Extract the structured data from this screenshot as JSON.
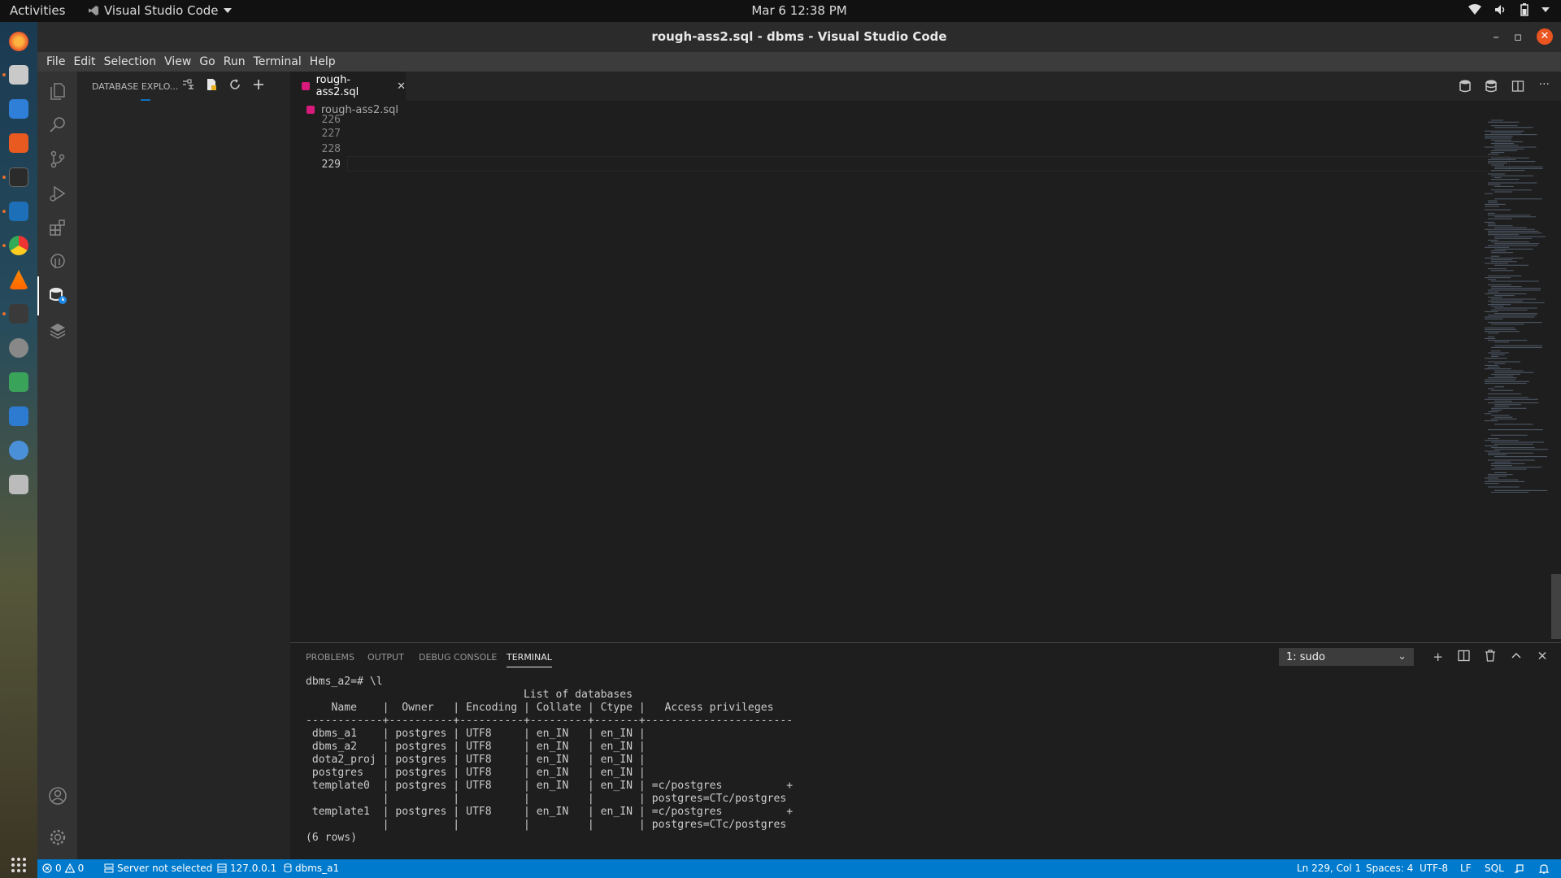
{
  "topbar": {
    "activities": "Activities",
    "app_name": "Visual Studio Code",
    "clock": "Mar 6  12:38 PM"
  },
  "window": {
    "title": "rough-ass2.sql - dbms - Visual Studio Code"
  },
  "menu": [
    "File",
    "Edit",
    "Selection",
    "View",
    "Go",
    "Run",
    "Terminal",
    "Help"
  ],
  "sidebar": {
    "title": "DATABASE EXPLO..."
  },
  "editor": {
    "tab_label": "rough-ass2.sql",
    "breadcrumb": "rough-ass2.sql",
    "line_numbers": [
      "226",
      "227",
      "228",
      "229"
    ]
  },
  "panel": {
    "tabs": [
      "PROBLEMS",
      "OUTPUT",
      "DEBUG CONSOLE",
      "TERMINAL"
    ],
    "active_tab": "TERMINAL",
    "terminal_select": "1: sudo",
    "terminal_lines": [
      "dbms_a2=# \\l",
      "                                  List of databases",
      "    Name    |  Owner   | Encoding | Collate | Ctype |   Access privileges",
      "------------+----------+----------+---------+-------+-----------------------",
      " dbms_a1    | postgres | UTF8     | en_IN   | en_IN |",
      " dbms_a2    | postgres | UTF8     | en_IN   | en_IN |",
      " dota2_proj | postgres | UTF8     | en_IN   | en_IN |",
      " postgres   | postgres | UTF8     | en_IN   | en_IN |",
      " template0  | postgres | UTF8     | en_IN   | en_IN | =c/postgres          +",
      "            |          |          |         |       | postgres=CTc/postgres",
      " template1  | postgres | UTF8     | en_IN   | en_IN | =c/postgres          +",
      "            |          |          |         |       | postgres=CTc/postgres",
      "(6 rows)"
    ]
  },
  "status": {
    "errors": "0",
    "warnings": "0",
    "server": "Server not selected",
    "host": "127.0.0.1",
    "database": "dbms_a1",
    "cursor": "Ln 229, Col 1",
    "spaces": "Spaces: 4",
    "encoding": "UTF-8",
    "eol": "LF",
    "language": "SQL"
  },
  "colors": {
    "accent": "#007acc",
    "editor_bg": "#1e1e1e",
    "sidebar_bg": "#252526",
    "activity_bg": "#333333",
    "close_button": "#e95420",
    "sql_icon": "#d81b7a"
  }
}
